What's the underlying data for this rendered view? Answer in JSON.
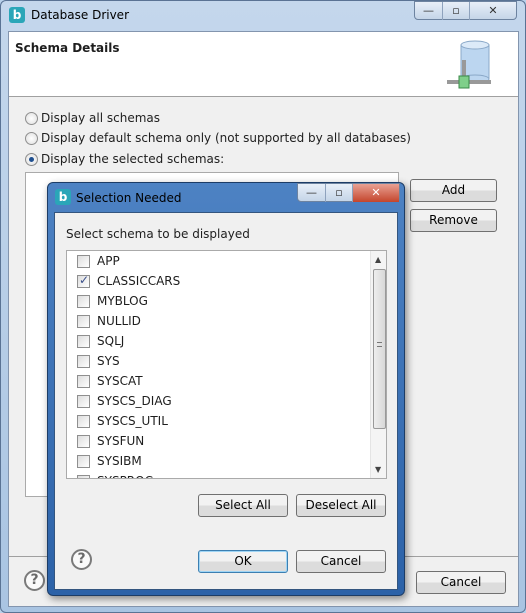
{
  "window": {
    "title": "Database Driver",
    "controls": {
      "minimize": "—",
      "maximize": "▫",
      "close": "✕"
    }
  },
  "header": {
    "title": "Schema Details",
    "icon": "database-icon"
  },
  "options": [
    {
      "label": "Display all schemas",
      "selected": false
    },
    {
      "label": "Display default schema only (not supported by all databases)",
      "selected": false
    },
    {
      "label": "Display the selected schemas:",
      "selected": true
    }
  ],
  "side_buttons": {
    "add": "Add",
    "remove": "Remove"
  },
  "footer": {
    "help": "?",
    "cancel": "Cancel"
  },
  "dialog": {
    "title": "Selection Needed",
    "prompt": "Select schema to be displayed",
    "schemas": [
      {
        "name": "APP",
        "checked": false
      },
      {
        "name": "CLASSICCARS",
        "checked": true
      },
      {
        "name": "MYBLOG",
        "checked": false
      },
      {
        "name": "NULLID",
        "checked": false
      },
      {
        "name": "SQLJ",
        "checked": false
      },
      {
        "name": "SYS",
        "checked": false
      },
      {
        "name": "SYSCAT",
        "checked": false
      },
      {
        "name": "SYSCS_DIAG",
        "checked": false
      },
      {
        "name": "SYSCS_UTIL",
        "checked": false
      },
      {
        "name": "SYSFUN",
        "checked": false
      },
      {
        "name": "SYSIBM",
        "checked": false
      },
      {
        "name": "SYSPROC",
        "checked": false
      }
    ],
    "select_all": "Select All",
    "deselect_all": "Deselect All",
    "help": "?",
    "ok": "OK",
    "cancel": "Cancel"
  }
}
